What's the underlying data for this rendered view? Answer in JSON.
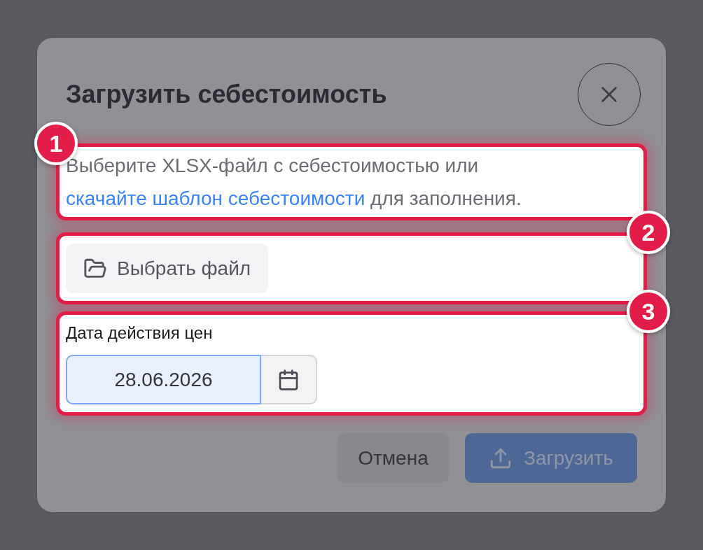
{
  "dialog": {
    "title": "Загрузить себестоимость"
  },
  "steps": [
    {
      "kind": "description",
      "badge": "1",
      "text_before": "Выберите XLSX-файл с себестоимостью или",
      "link": "скачайте шаблон себестоимости",
      "text_after": "для заполнения."
    },
    {
      "kind": "file",
      "badge": "2",
      "button": "Выбрать файл"
    },
    {
      "kind": "date",
      "badge": "3",
      "label": "Дата действия цен",
      "value": "28.06.2026",
      "focused": true
    }
  ],
  "footer": {
    "cancel": "Отмена",
    "submit": {
      "label": "Загрузить",
      "disabled": true
    }
  }
}
